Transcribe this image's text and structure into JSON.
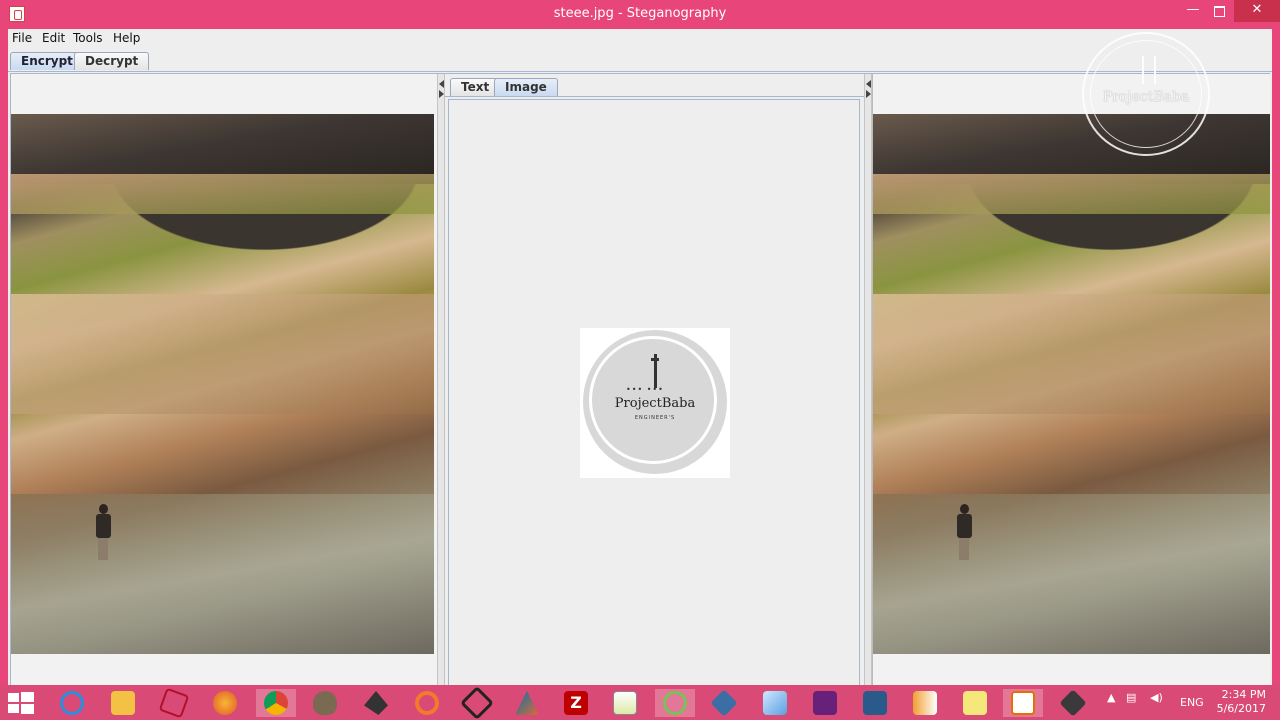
{
  "window": {
    "title": "steee.jpg - Steganography",
    "minimize": "—",
    "close": "✕"
  },
  "menu": {
    "file": "File",
    "edit": "Edit",
    "tools": "Tools",
    "help": "Help"
  },
  "main_tabs": [
    "Encrypt",
    "Decrypt"
  ],
  "main_tabs_selected": "Encrypt",
  "center_tabs": [
    "Text",
    "Image"
  ],
  "center_tabs_selected": "Image",
  "hidden_image": {
    "brand": "ProjectBaba",
    "tagline": "ENGINEER'S",
    "dots": "••• •••"
  },
  "watermark": {
    "text": "ProjectBaba"
  },
  "taskbar": {
    "apps": [
      "internet-explorer",
      "file-explorer",
      "app-red-tool",
      "firefox",
      "chrome",
      "gimp",
      "inkscape",
      "blender",
      "unity",
      "matlab",
      "filezilla",
      "chart-app",
      "android-studio",
      "virtualbox",
      "cube-app",
      "visual-studio",
      "mysql-workbench",
      "file-transfer",
      "sticky-notes",
      "java",
      "python-app"
    ],
    "active_app": "java",
    "language": "ENG",
    "time": "2:34 PM",
    "date": "5/6/2017"
  },
  "colors": {
    "accent": "#e8457a",
    "taskbar": "#d94a76",
    "tab_selected": "#c9daf0"
  }
}
